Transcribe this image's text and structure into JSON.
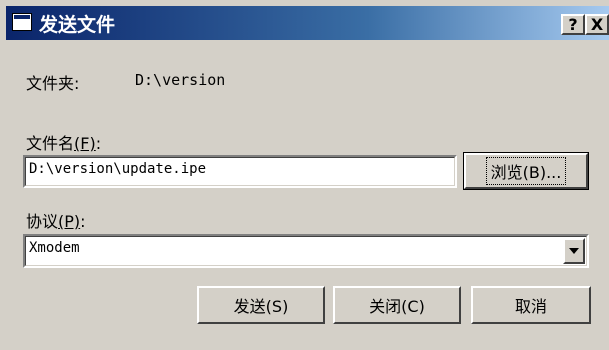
{
  "window": {
    "title": "发送文件",
    "help_label": "?",
    "close_label": "X"
  },
  "folder": {
    "label": "文件夹:",
    "value": "D:\\version"
  },
  "filename": {
    "label": "文件名",
    "accel": "(F)",
    "suffix": ":",
    "value": "D:\\version\\update.ipe",
    "browse_label": "浏览(B)..."
  },
  "protocol": {
    "label": "协议",
    "accel": "(P)",
    "suffix": ":",
    "value": "Xmodem"
  },
  "buttons": {
    "send": "发送(S)",
    "close": "关闭(C)",
    "cancel": "取消"
  },
  "colors": {
    "title_start": "#0a246a",
    "title_end": "#a6caf0",
    "face": "#d4d0c8"
  }
}
